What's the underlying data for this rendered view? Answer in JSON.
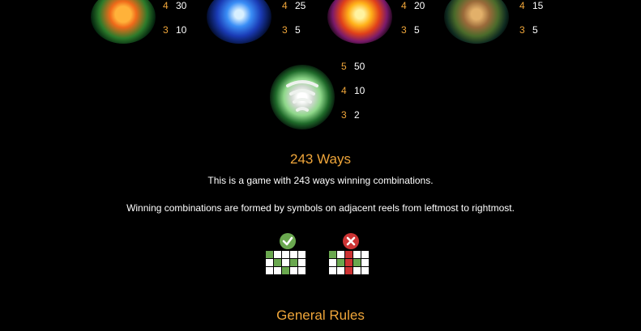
{
  "colors": {
    "accent": "#f0a63a",
    "text": "#ffffff",
    "good": "#6aa84f",
    "bad": "#cc3333"
  },
  "symbols": [
    {
      "icon": "lily-flower-icon",
      "pays": [
        {
          "count": "4",
          "value": "30"
        },
        {
          "count": "3",
          "value": "10"
        }
      ]
    },
    {
      "icon": "blue-water-orb-icon",
      "pays": [
        {
          "count": "4",
          "value": "25"
        },
        {
          "count": "3",
          "value": "5"
        }
      ]
    },
    {
      "icon": "fire-orb-icon",
      "pays": [
        {
          "count": "4",
          "value": "20"
        },
        {
          "count": "3",
          "value": "5"
        }
      ]
    },
    {
      "icon": "earth-tree-icon",
      "pays": [
        {
          "count": "4",
          "value": "15"
        },
        {
          "count": "3",
          "value": "5"
        }
      ]
    },
    {
      "icon": "wind-tornado-icon",
      "pays": [
        {
          "count": "5",
          "value": "50"
        },
        {
          "count": "4",
          "value": "10"
        },
        {
          "count": "3",
          "value": "2"
        }
      ]
    }
  ],
  "ways": {
    "title": "243 Ways",
    "line1": "This is a game with 243 ways winning combinations.",
    "line2": "Winning combinations are formed by symbols on adjacent reels from leftmost to rightmost."
  },
  "examples": [
    {
      "icon": "check-icon",
      "result": "valid"
    },
    {
      "icon": "cross-icon",
      "result": "invalid"
    }
  ],
  "general_rules": {
    "title": "General Rules"
  }
}
